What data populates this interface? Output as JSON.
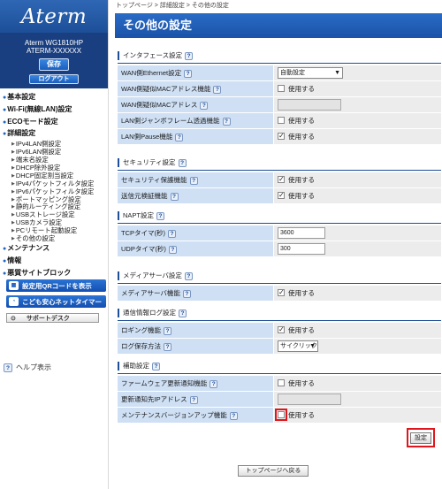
{
  "sidebar": {
    "logo": "Aterm",
    "model": "Aterm WG1810HP",
    "device_id": "ATERM-XXXXXX",
    "save_label": "保存",
    "logout_label": "ログアウト",
    "nav": [
      {
        "type": "main",
        "label": "基本設定"
      },
      {
        "type": "main",
        "label": "Wi-Fi(無線LAN)設定"
      },
      {
        "type": "main",
        "label": "ECOモード設定"
      },
      {
        "type": "main",
        "label": "詳細設定"
      },
      {
        "type": "sub",
        "label": "IPv4LAN側設定"
      },
      {
        "type": "sub",
        "label": "IPv6LAN側設定"
      },
      {
        "type": "sub",
        "label": "端末名設定"
      },
      {
        "type": "sub",
        "label": "DHCP除外設定"
      },
      {
        "type": "sub",
        "label": "DHCP固定割当設定"
      },
      {
        "type": "sub",
        "label": "IPv4パケットフィルタ設定"
      },
      {
        "type": "sub",
        "label": "IPv6パケットフィルタ設定"
      },
      {
        "type": "sub",
        "label": "ポートマッピング設定"
      },
      {
        "type": "sub",
        "label": "静的ルーティング設定"
      },
      {
        "type": "sub",
        "label": "USBストレージ設定"
      },
      {
        "type": "sub",
        "label": "USBカメラ設定"
      },
      {
        "type": "sub",
        "label": "PCリモート起動設定"
      },
      {
        "type": "sub",
        "label": "その他の設定"
      },
      {
        "type": "main",
        "label": "メンテナンス"
      },
      {
        "type": "main",
        "label": "情報"
      },
      {
        "type": "main",
        "label": "悪質サイトブロック"
      }
    ],
    "qr_button": "設定用QRコードを表示",
    "kids_timer_button": "こども安心ネットタイマー",
    "support_label": "サポートデスク",
    "help_label": "ヘルプ表示"
  },
  "header": {
    "breadcrumb": "トップページ > 詳細設定 > その他の設定",
    "title": "その他の設定"
  },
  "help_glyph": "?",
  "check_mark": "✓",
  "sections": {
    "interface": {
      "title": "インタフェース設定",
      "rows": [
        {
          "label": "WAN側Ethernet設定",
          "value": "自動設定"
        },
        {
          "label": "WAN側疑似MACアドレス機能",
          "value": "使用する",
          "checked": false
        },
        {
          "label": "WAN側疑似MACアドレス",
          "value": ""
        },
        {
          "label": "LAN側ジャンボフレーム透過機能",
          "value": "使用する",
          "checked": false
        },
        {
          "label": "LAN側Pause機能",
          "value": "使用する",
          "checked": true
        }
      ]
    },
    "security": {
      "title": "セキュリティ設定",
      "rows": [
        {
          "label": "セキュリティ保護機能",
          "value": "使用する",
          "checked": true
        },
        {
          "label": "送信元検証機能",
          "value": "使用する",
          "checked": true
        }
      ]
    },
    "napt": {
      "title": "NAPT設定",
      "rows": [
        {
          "label": "TCPタイマ(秒)",
          "value": "3600"
        },
        {
          "label": "UDPタイマ(秒)",
          "value": "300"
        }
      ]
    },
    "media": {
      "title": "メディアサーバ設定",
      "rows": [
        {
          "label": "メディアサーバ機能",
          "value": "使用する",
          "checked": true
        }
      ]
    },
    "log": {
      "title": "通信情報ログ設定",
      "rows": [
        {
          "label": "ロギング機能",
          "value": "使用する",
          "checked": true
        },
        {
          "label": "ログ保存方法",
          "value": "サイクリック"
        }
      ]
    },
    "aux": {
      "title": "補助設定",
      "rows": [
        {
          "label": "ファームウェア更新通知機能",
          "value": "使用する",
          "checked": false
        },
        {
          "label": "更新通知先IPアドレス",
          "value": ""
        },
        {
          "label": "メンテナンスバージョンアップ機能",
          "value": "使用する",
          "checked": false
        }
      ]
    }
  },
  "buttons": {
    "set": "設定",
    "back_to_top": "トップページへ戻る"
  },
  "colors": {
    "accent": "#1a53a8",
    "label_bg": "#cfe0f5",
    "highlight": "#e0161c"
  }
}
